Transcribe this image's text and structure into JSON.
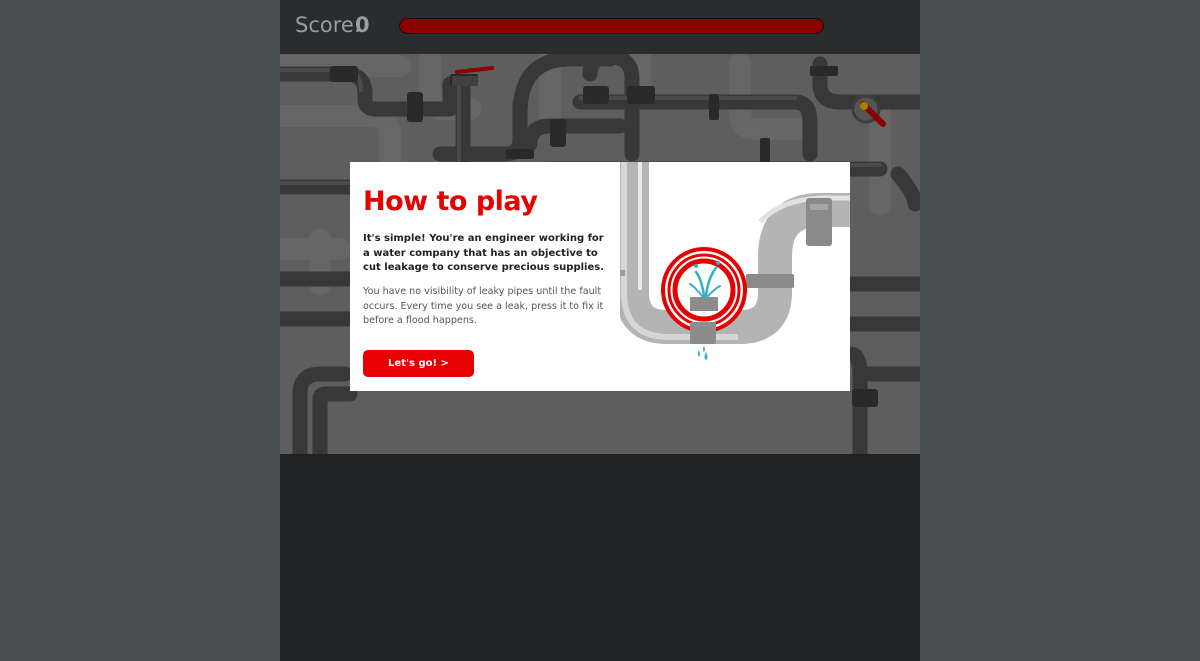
{
  "header": {
    "score_label": "Score:",
    "score_value": "0",
    "flood_level": 1.0
  },
  "modal": {
    "title": "How to play",
    "intro": "It's simple! You're an engineer working for a water company that has an objective to cut leakage to conserve precious supplies.",
    "body": "You have no visibility of leaky pipes until the fault occurs. Every time you see a leak, press it to fix it before a flood happens.",
    "button_label": "Let's go! >"
  },
  "icons": [
    "valve-handle-icon",
    "leak-icon",
    "water-drop-icon"
  ],
  "colors": {
    "brand_red": "#e60000",
    "flood_bar": "#8e0000",
    "pipe_grey": "#5f5f5f",
    "board_background": "#838383",
    "frame_dark": "#202122"
  }
}
